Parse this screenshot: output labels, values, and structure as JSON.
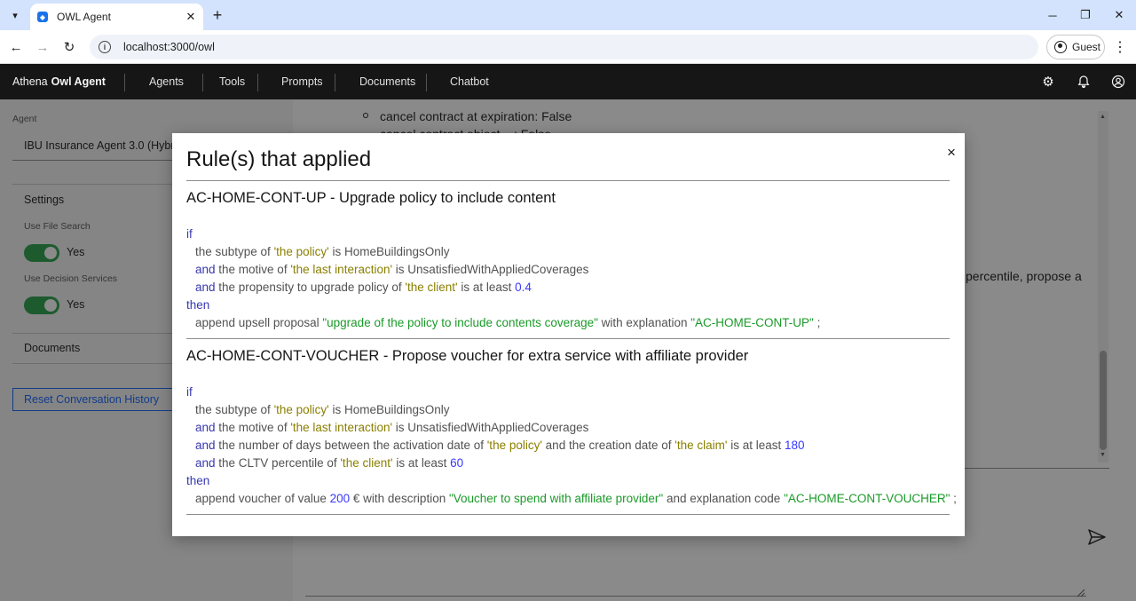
{
  "browser": {
    "tab_title": "OWL Agent",
    "url": "localhost:3000/owl",
    "profile_label": "Guest"
  },
  "app": {
    "brand_prefix": "Athena",
    "brand_name": "Owl Agent",
    "nav": [
      "Agents",
      "Tools",
      "Prompts",
      "Documents",
      "Chatbot"
    ]
  },
  "sidebar": {
    "agent_label": "Agent",
    "agent_value": "IBU Insurance Agent 3.0 (Hybri",
    "settings_title": "Settings",
    "file_search_label": "Use File Search",
    "file_search_value": "Yes",
    "decision_label": "Use Decision Services",
    "decision_value": "Yes",
    "documents_title": "Documents",
    "reset_button": "Reset Conversation History"
  },
  "chat": {
    "line1": "cancel contract at expiration: False",
    "line2": "cancel contract object ...: False",
    "line3": "percentile, propose a"
  },
  "modal": {
    "title": "Rule(s) that applied",
    "close": "×",
    "rules": [
      {
        "name": "AC-HOME-CONT-UP - Upgrade policy to include content",
        "if": "if",
        "l1_a": "the subtype of ",
        "l1_s": "'the policy'",
        "l1_b": " is HomeBuildingsOnly",
        "and": "and",
        "l2_a": " the motive of ",
        "l2_s": "'the last interaction'",
        "l2_b": " is UnsatisfiedWithAppliedCoverages",
        "l3_a": " the propensity to upgrade policy of ",
        "l3_s": "'the client'",
        "l3_b": " is at least ",
        "l3_n": "0.4",
        "then": "then",
        "l4_a": "append upsell proposal ",
        "l4_l": "\"upgrade of the policy to include contents coverage\"",
        "l4_b": " with explanation ",
        "l4_c": "\"AC-HOME-CONT-UP\"",
        "l4_d": " ;"
      },
      {
        "name": "AC-HOME-CONT-VOUCHER - Propose voucher for extra service with affiliate provider",
        "if": "if",
        "l1_a": "the subtype of ",
        "l1_s": "'the policy'",
        "l1_b": " is HomeBuildingsOnly",
        "and": "and",
        "l2_a": " the motive of ",
        "l2_s": "'the last interaction'",
        "l2_b": " is UnsatisfiedWithAppliedCoverages",
        "l3_a": " the number of days between the activation date of ",
        "l3_s": "'the policy'",
        "l3_b": " and the creation date of ",
        "l3_s2": "'the claim'",
        "l3_c": " is at least ",
        "l3_n": "180",
        "l4_a": " the CLTV percentile of ",
        "l4_s": "'the client'",
        "l4_b": " is at least ",
        "l4_n": "60",
        "then": "then",
        "l5_a": "append voucher of value ",
        "l5_n": "200",
        "l5_b": " € with description ",
        "l5_l": "\"Voucher to spend with affiliate provider\"",
        "l5_c": " and explanation code ",
        "l5_l2": "\"AC-HOME-CONT-VOUCHER\"",
        "l5_d": " ;"
      }
    ]
  },
  "colors": {
    "header_bg": "#161616",
    "toggle_on": "#24a148",
    "accent": "#0f62fe",
    "keyword": "#3838b0",
    "string_ref": "#8a7f00",
    "literal": "#1a9a28"
  }
}
